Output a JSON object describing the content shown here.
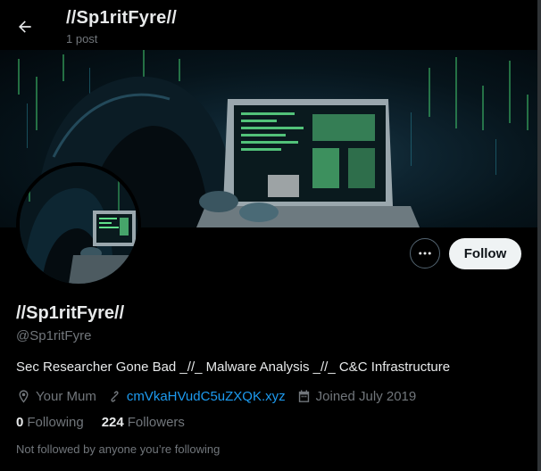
{
  "header": {
    "back_icon": "arrow-left-icon",
    "title": "//Sp1ritFyre//",
    "post_count": "1 post"
  },
  "banner": {
    "description_icon": "hooded-hacker-laptop-image"
  },
  "actions": {
    "more_icon": "more-dots-icon",
    "follow_label": "Follow"
  },
  "profile": {
    "display_name": "//Sp1ritFyre//",
    "handle": "@Sp1ritFyre",
    "bio": "Sec Researcher Gone Bad _//_ Malware Analysis _//_ C&C Infrastructure",
    "location": "Your Mum",
    "website": "cmVkaHVudC5uZXQK.xyz",
    "joined": "Joined July 2019",
    "following_count": "0",
    "following_label": "Following",
    "followers_count": "224",
    "followers_label": "Followers",
    "not_followed_text": "Not followed by anyone you’re following"
  },
  "colors": {
    "background": "#000000",
    "primary_text": "#e7e9ea",
    "secondary_text": "#71767b",
    "link": "#1d9bf0",
    "follow_button_bg": "#eff3f4"
  }
}
